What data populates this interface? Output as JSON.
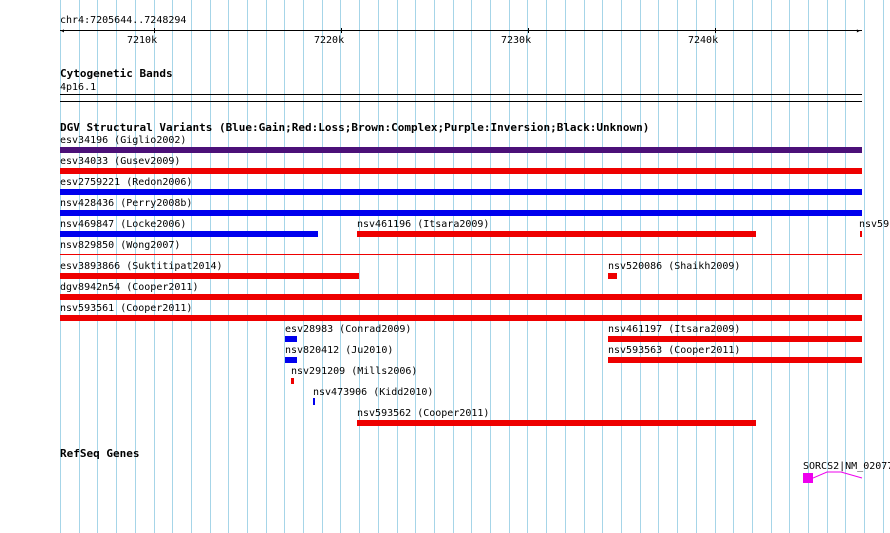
{
  "ruler": {
    "position": "chr4:7205644..7248294",
    "ticks": [
      "7210k",
      "7220k",
      "7230k",
      "7240k"
    ]
  },
  "cytoband": {
    "title": "Cytogenetic Bands",
    "band": "4p16.1"
  },
  "dgv": {
    "title": "DGV Structural Variants (Blue:Gain;Red:Loss;Brown:Complex;Purple:Inversion;Black:Unknown)",
    "colors": {
      "gain": "#0000ee",
      "loss": "#ee0000",
      "inversion": "#4b1078"
    },
    "variants": [
      {
        "label": "esv34196 (Giglio2002)",
        "type": "inversion"
      },
      {
        "label": "esv34033 (Gusev2009)",
        "type": "loss"
      },
      {
        "label": "esv2759221 (Redon2006)",
        "type": "gain"
      },
      {
        "label": "nsv428436 (Perry2008b)",
        "type": "gain"
      },
      {
        "label": "nsv469847 (Locke2006)",
        "type": "gain"
      },
      {
        "label": "nsv461196 (Itsara2009)",
        "type": "loss"
      },
      {
        "label": "nsv59",
        "type": "loss"
      },
      {
        "label": "nsv829850 (Wong2007)",
        "type": "loss"
      },
      {
        "label": "esv3893866 (Suktitipat2014)",
        "type": "loss"
      },
      {
        "label": "nsv520086 (Shaikh2009)",
        "type": "loss"
      },
      {
        "label": "dgv8942n54 (Cooper2011)",
        "type": "loss"
      },
      {
        "label": "nsv593561 (Cooper2011)",
        "type": "loss"
      },
      {
        "label": "esv28983 (Conrad2009)",
        "type": "gain"
      },
      {
        "label": "nsv461197 (Itsara2009)",
        "type": "loss"
      },
      {
        "label": "nsv820412 (Ju2010)",
        "type": "gain"
      },
      {
        "label": "nsv593563 (Cooper2011)",
        "type": "loss"
      },
      {
        "label": "nsv291209 (Mills2006)",
        "type": "loss"
      },
      {
        "label": "nsv473906 (Kidd2010)",
        "type": "gain"
      },
      {
        "label": "nsv593562 (Cooper2011)",
        "type": "loss"
      }
    ]
  },
  "refseq": {
    "title": "RefSeq Genes",
    "gene_label": "SORCS2|NM_02077",
    "color": "#ee00ee"
  }
}
